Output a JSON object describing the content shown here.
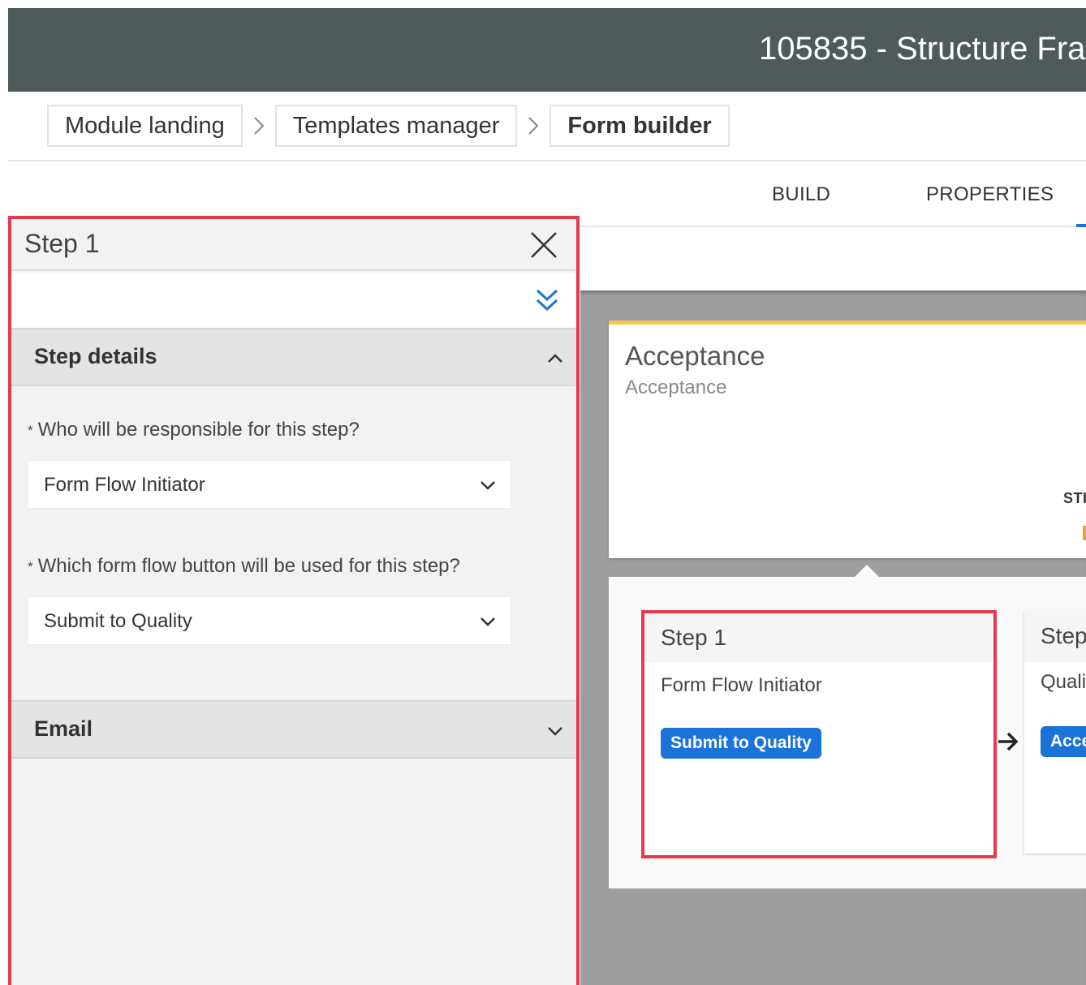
{
  "header": {
    "title": "105835 - Structure Fra"
  },
  "breadcrumb": {
    "items": [
      "Module landing",
      "Templates manager",
      "Form builder"
    ]
  },
  "tabs": {
    "build": "BUILD",
    "properties": "PROPERTIES"
  },
  "canvas": {
    "phase_card": {
      "title": "Acceptance",
      "subtitle": "Acceptance",
      "stat_label": "STI"
    },
    "steps": [
      {
        "title": "Step 1",
        "responsible": "Form Flow Initiator",
        "button": "Submit to Quality"
      },
      {
        "title": "Step",
        "responsible": "Quali",
        "button": "Acce"
      }
    ]
  },
  "panel": {
    "title": "Step 1",
    "sections": {
      "step_details": {
        "title": "Step details",
        "responsible_label": "Who will be responsible for this step?",
        "responsible_value": "Form Flow Initiator",
        "button_label": "Which form flow button will be used for this step?",
        "button_value": "Submit to Quality"
      },
      "email": {
        "title": "Email"
      }
    },
    "required_marker": "*"
  },
  "colors": {
    "header_bg": "#4f5a5b",
    "accent_blue": "#1a73d9",
    "highlight_red": "#e53a4a",
    "phase_yellow": "#f5c550"
  },
  "icons": [
    "chevron-right-icon",
    "close-icon",
    "double-chevron-down-icon",
    "chevron-up-icon",
    "chevron-down-icon",
    "arrow-right-icon"
  ]
}
